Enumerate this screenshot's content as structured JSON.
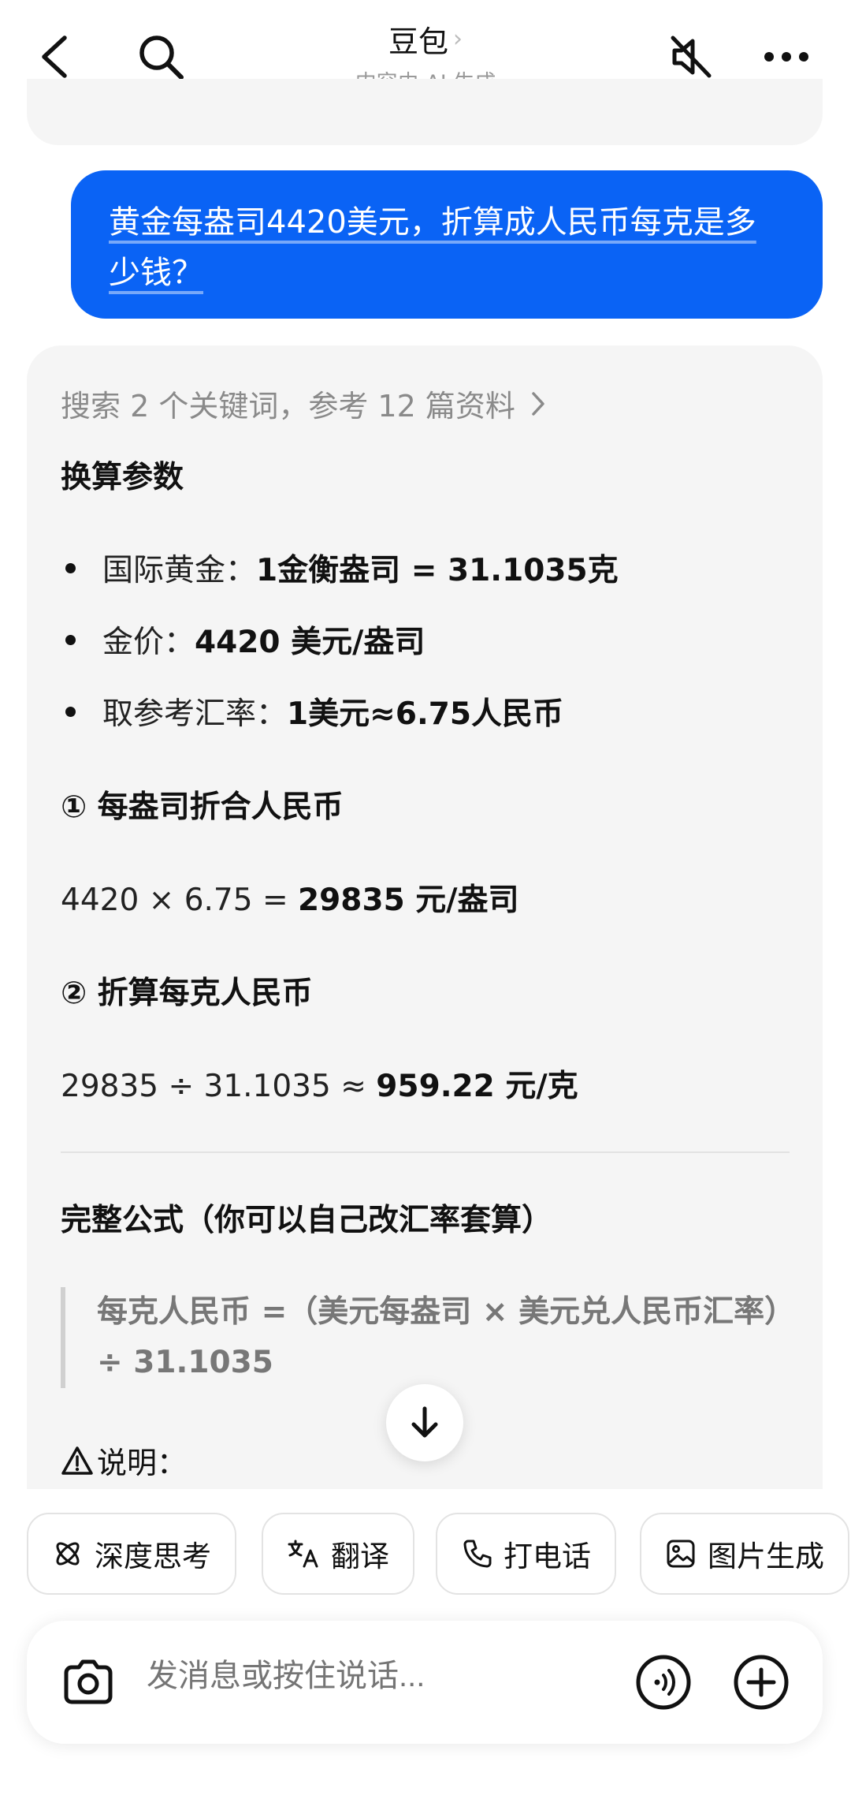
{
  "header": {
    "title": "豆包",
    "subtitle": "内容由 AI 生成"
  },
  "user_message": "黄金每盎司4420美元，折算成人民币每克是多少钱？",
  "answer": {
    "search_summary": "搜索 2 个关键词，参考 12 篇资料",
    "section1_title": "换算参数",
    "bullets": [
      {
        "label": "国际黄金：",
        "value": "1金衡盎司 = 31.1035克"
      },
      {
        "label": "金价：",
        "value": "4420 美元/盎司"
      },
      {
        "label": "取参考汇率：",
        "value": "1美元≈6.75人民币"
      }
    ],
    "step1_title": "① 每盎司折合人民币",
    "step1_expr": "4420 × 6.75 = ",
    "step1_result": "29835 元/盎司",
    "step2_title": "② 折算每克人民币",
    "step2_expr": "29835 ÷ 31.1035 ≈ ",
    "step2_result": "959.22 元/克",
    "formula_title": "完整公式（你可以自己改汇率套算）",
    "formula_quote": "每克人民币 =（美元每盎司 × 美元兑人民币汇率）÷ 31.1035",
    "note_label": "说明："
  },
  "chips": [
    {
      "label": "深度思考",
      "icon": "atom-icon"
    },
    {
      "label": "翻译",
      "icon": "translate-icon"
    },
    {
      "label": "打电话",
      "icon": "phone-icon"
    },
    {
      "label": "图片生成",
      "icon": "image-icon"
    }
  ],
  "input": {
    "placeholder": "发消息或按住说话..."
  },
  "colors": {
    "accent": "#0a63f5",
    "card_bg": "#f5f5f5"
  }
}
